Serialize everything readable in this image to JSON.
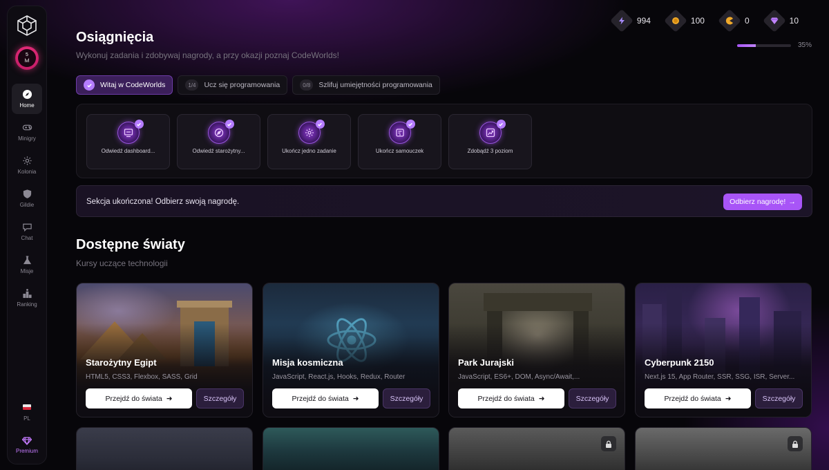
{
  "sidebar": {
    "avatar": {
      "level": "5",
      "level_unit": "lvl"
    },
    "items": [
      {
        "label": "Home",
        "icon": "compass-icon",
        "active": true
      },
      {
        "label": "Minigry",
        "icon": "gamepad-icon",
        "active": false
      },
      {
        "label": "Kolonia",
        "icon": "gear-icon",
        "active": false
      },
      {
        "label": "Gildie",
        "icon": "shield-icon",
        "active": false
      },
      {
        "label": "Chat",
        "icon": "chat-icon",
        "active": false
      },
      {
        "label": "Misje",
        "icon": "flask-icon",
        "active": false
      },
      {
        "label": "Ranking",
        "icon": "podium-icon",
        "active": false
      }
    ],
    "language": "PL",
    "premium": "Premium"
  },
  "header": {
    "title": "Osiągnięcia",
    "subtitle": "Wykonuj zadania i zdobywaj nagrody, a przy okazji poznaj CodeWorlds!"
  },
  "stats": [
    {
      "icon": "lightning-icon",
      "value": "994"
    },
    {
      "icon": "coin-icon",
      "value": "100"
    },
    {
      "icon": "pacman-icon",
      "value": "0"
    },
    {
      "icon": "gem-icon",
      "value": "10"
    }
  ],
  "progress": {
    "percent": 35,
    "label": "35%"
  },
  "tabs": [
    {
      "label": "Witaj w CodeWorlds",
      "badge": "",
      "active": true
    },
    {
      "label": "Ucz się programowania",
      "badge": "1/4",
      "active": false
    },
    {
      "label": "Szlifuj umiejętności programowania",
      "badge": "0/8",
      "active": false
    }
  ],
  "achievements": [
    {
      "label": "Odwiedź dashboard...",
      "icon": "dashboard-icon"
    },
    {
      "label": "Odwiedź starożytny...",
      "icon": "compass-icon"
    },
    {
      "label": "Ukończ jedno zadanie",
      "icon": "gear-icon"
    },
    {
      "label": "Ukończ samouczek",
      "icon": "tutorial-icon"
    },
    {
      "label": "Zdobądź 3 poziom",
      "icon": "chart-up-icon"
    }
  ],
  "reward": {
    "text": "Sekcja ukończona! Odbierz swoją nagrodę.",
    "button": "Odbierz nagrodę!"
  },
  "worlds_section": {
    "title": "Dostępne światy",
    "subtitle": "Kursy uczące technologii"
  },
  "worlds": [
    {
      "name": "Starożytny Egipt",
      "tech": "HTML5, CSS3, Flexbox, SASS, Grid",
      "go": "Przejdź do świata",
      "details": "Szczegóły"
    },
    {
      "name": "Misja kosmiczna",
      "tech": "JavaScript, React.js, Hooks, Redux, Router",
      "go": "Przejdź do świata",
      "details": "Szczegóły"
    },
    {
      "name": "Park Jurajski",
      "tech": "JavaScript, ES6+, DOM, Async/Await,...",
      "go": "Przejdź do świata",
      "details": "Szczegóły"
    },
    {
      "name": "Cyberpunk 2150",
      "tech": "Next.js 15, App Router, SSR, SSG, ISR, Server...",
      "go": "Przejdź do świata",
      "details": "Szczegóły"
    }
  ],
  "accent_color": "#a855f7"
}
